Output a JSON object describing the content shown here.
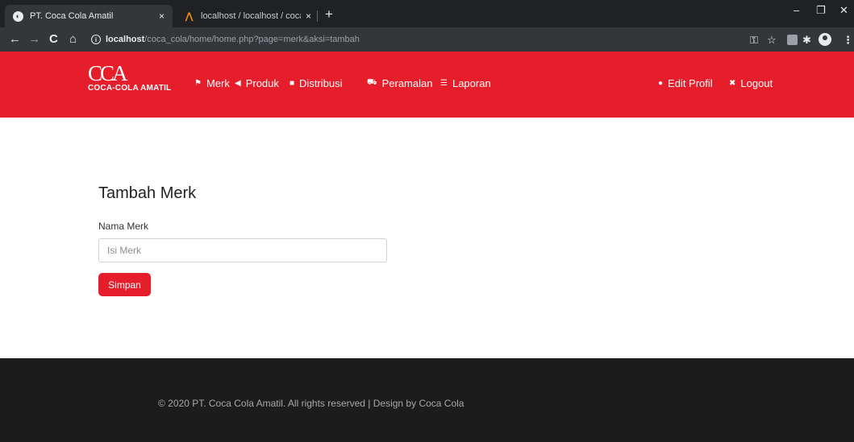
{
  "browser": {
    "tabs": [
      {
        "title": "PT. Coca Cola Amatil",
        "close": "×"
      },
      {
        "title": "localhost / localhost / coca_cola",
        "close": "×"
      }
    ],
    "new_tab": "+",
    "window_controls": {
      "minimize": "–",
      "restore": "❐",
      "close": "✕"
    },
    "nav": {
      "back": "←",
      "forward": "→",
      "reload": "C",
      "home": "⌂"
    },
    "url_host": "localhost",
    "url_path": "/coca_cola/home/home.php?page=merk&aksi=tambah",
    "toolbar_icons": {
      "key": "⚿",
      "star": "☆",
      "puzzle": "✱",
      "menu": "⋮"
    }
  },
  "navbar": {
    "logo_main": "CCA",
    "logo_sub": "COCA-COLA AMATIL",
    "items": [
      {
        "label": "Merk",
        "icon": "flag-icon"
      },
      {
        "label": "Produk",
        "icon": "bullhorn-icon"
      },
      {
        "label": "Distribusi",
        "icon": "truck-icon"
      },
      {
        "label": "Peramalan",
        "icon": "cart-icon"
      },
      {
        "label": "Laporan",
        "icon": "list-icon"
      }
    ],
    "right_items": [
      {
        "label": "Edit Profil",
        "icon": "user-icon"
      },
      {
        "label": "Logout",
        "icon": "close-icon"
      }
    ]
  },
  "form": {
    "title": "Tambah Merk",
    "label": "Nama Merk",
    "value": "",
    "placeholder": "Isi Merk",
    "submit_label": "Simpan"
  },
  "footer": {
    "text": "© 2020 PT. Coca Cola Amatil. All rights reserved | Design by Coca Cola"
  },
  "colors": {
    "brand_red": "#e61d2b",
    "footer_bg": "#1c1c1c",
    "chrome_dark": "#202124"
  }
}
